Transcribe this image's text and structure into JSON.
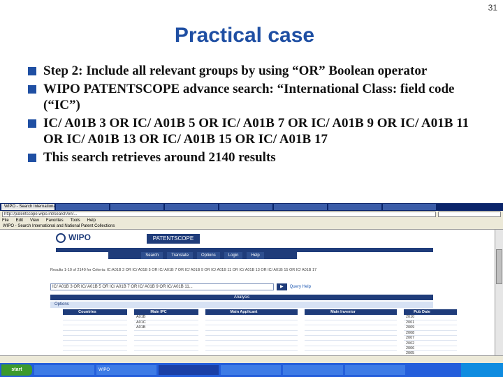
{
  "slide": {
    "number": "31",
    "title": "Practical case",
    "bullets": [
      "Step 2: Include all relevant groups by using “OR” Boolean operator",
      "WIPO PATENTSCOPE advance search: “International Class: field code (“IC”)",
      "IC/ A01B 3 OR IC/ A01B 5 OR IC/ A01B 7 OR IC/ A01B 9 OR IC/ A01B 11 OR IC/ A01B 13 OR IC/ A01B 15 OR IC/ A01B 17",
      "This search retrieves around 2140 results"
    ]
  },
  "browser": {
    "tabs": [
      "WIPO - Search International and",
      "",
      "",
      "",
      "",
      "",
      "",
      ""
    ],
    "address": "http://patentscope.wipo.int/search/en/...",
    "menu": [
      "File",
      "Edit",
      "View",
      "Favorites",
      "Tools",
      "Help"
    ],
    "favorites_title": "WIPO - Search International and National Patent Collections",
    "wipo_logo": "WIPO",
    "patentscope": "PATENTSCOPE",
    "nav": [
      "Search",
      "Translate",
      "Options",
      "Login",
      "Help"
    ],
    "query_text": "Results 1-10 of 2140 for Criteria: IC:A01B 3 OR IC/ A01B 5 OR IC/ A01B 7 OR IC/ A01B 9 OR IC/ A01B 11 OR IC/ A01B 13 OR IC/ A01B 15 OR IC/ A01B 17",
    "search_field": "IC/ A01B 3 OR IC/ A01B 5 OR IC/ A01B 7 OR IC/ A01B 9 OR IC/ A01B 11...",
    "query_link": "Query Help",
    "analysis_label": "Analysis",
    "options_label": "Options",
    "tables": [
      {
        "headers": [
          "Countries",
          ""
        ],
        "rows": [
          [
            "",
            ""
          ],
          [
            "",
            ""
          ],
          [
            "",
            ""
          ],
          [
            "",
            ""
          ],
          [
            "",
            ""
          ],
          [
            "",
            ""
          ],
          [
            "",
            ""
          ],
          [
            "",
            ""
          ],
          [
            "",
            ""
          ],
          [
            "",
            ""
          ],
          [
            "",
            ""
          ],
          [
            "",
            ""
          ]
        ]
      },
      {
        "headers": [
          "Main IPC",
          ""
        ],
        "rows": [
          [
            "A01B",
            ""
          ],
          [
            "A01C",
            ""
          ],
          [
            "A01B",
            ""
          ],
          [
            "",
            ""
          ],
          [
            "",
            ""
          ],
          [
            "",
            ""
          ],
          [
            "",
            ""
          ],
          [
            "",
            ""
          ],
          [
            "",
            ""
          ],
          [
            "",
            ""
          ],
          [
            "",
            ""
          ],
          [
            "",
            ""
          ]
        ]
      },
      {
        "headers": [
          "Main Applicant",
          ""
        ],
        "rows": [
          [
            "",
            ""
          ],
          [
            "",
            ""
          ],
          [
            "",
            ""
          ],
          [
            "",
            ""
          ],
          [
            "",
            ""
          ],
          [
            "",
            ""
          ],
          [
            "",
            ""
          ],
          [
            "",
            ""
          ],
          [
            "",
            ""
          ],
          [
            "",
            ""
          ],
          [
            "",
            ""
          ],
          [
            "",
            ""
          ]
        ]
      },
      {
        "headers": [
          "Main Inventor",
          ""
        ],
        "rows": [
          [
            "",
            ""
          ],
          [
            "",
            ""
          ],
          [
            "",
            ""
          ],
          [
            "",
            ""
          ],
          [
            "",
            ""
          ],
          [
            "",
            ""
          ],
          [
            "",
            ""
          ],
          [
            "",
            ""
          ],
          [
            "",
            ""
          ],
          [
            "",
            ""
          ],
          [
            "",
            ""
          ],
          [
            "",
            ""
          ]
        ]
      },
      {
        "headers": [
          "Pub Date",
          ""
        ],
        "rows": [
          [
            "2010",
            ""
          ],
          [
            "2001",
            ""
          ],
          [
            "2009",
            ""
          ],
          [
            "2008",
            ""
          ],
          [
            "2007",
            ""
          ],
          [
            "2002",
            ""
          ],
          [
            "2006",
            ""
          ],
          [
            "2005",
            ""
          ],
          [
            "2004",
            ""
          ],
          [
            "2003",
            ""
          ],
          [
            "2011",
            ""
          ],
          [
            "",
            ""
          ]
        ]
      }
    ],
    "status": "",
    "taskbar": {
      "start": "start",
      "tasks": [
        "",
        "WIPO",
        "",
        "",
        "",
        "",
        ""
      ],
      "clock": ""
    }
  }
}
